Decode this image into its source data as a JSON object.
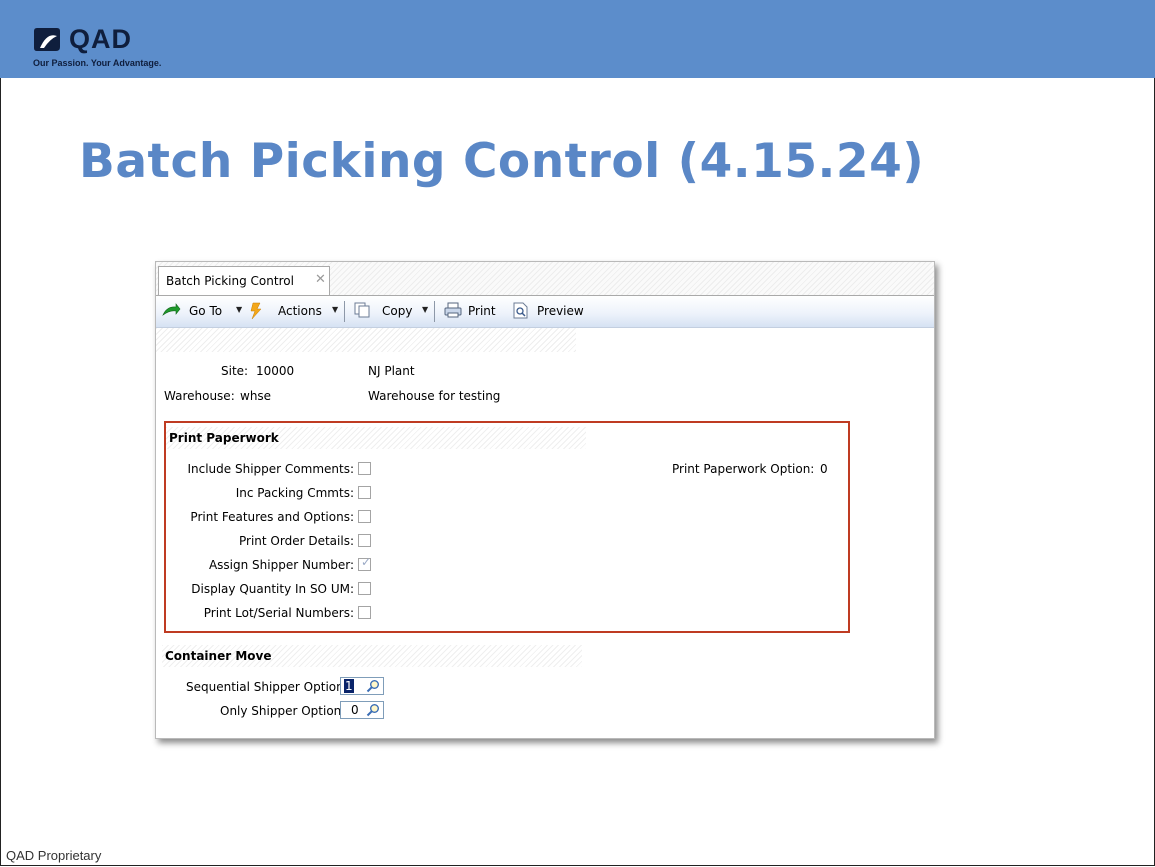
{
  "colors": {
    "header_band": "#5c8dcb",
    "title": "#5a87c6",
    "highlight_border": "#bf3b22",
    "selection": "#0a246a"
  },
  "brand": {
    "logo_text": "QAD",
    "tagline": "Our Passion. Your Advantage."
  },
  "slide": {
    "title": "Batch Picking Control (4.15.24)",
    "footer": "QAD Proprietary"
  },
  "window": {
    "tab": {
      "label": "Batch Picking Control",
      "close_icon": "close-icon"
    },
    "toolbar": {
      "goto_label": "Go To",
      "actions_label": "Actions",
      "copy_label": "Copy",
      "print_label": "Print",
      "preview_label": "Preview"
    },
    "header_fields": {
      "site_label": "Site:",
      "site_value": "10000",
      "site_desc": "NJ Plant",
      "warehouse_label": "Warehouse:",
      "warehouse_value": "whse",
      "warehouse_desc": "Warehouse for testing"
    },
    "print_paperwork": {
      "title": "Print Paperwork",
      "option_label": "Print Paperwork Option:",
      "option_value": "0",
      "items": [
        {
          "label": "Include Shipper Comments:",
          "checked": false
        },
        {
          "label": "Inc Packing Cmmts:",
          "checked": false
        },
        {
          "label": "Print Features and Options:",
          "checked": false
        },
        {
          "label": "Print Order Details:",
          "checked": false
        },
        {
          "label": "Assign Shipper Number:",
          "checked": true
        },
        {
          "label": "Display Quantity In SO UM:",
          "checked": false
        },
        {
          "label": "Print Lot/Serial Numbers:",
          "checked": false
        }
      ]
    },
    "container_move": {
      "title": "Container Move",
      "sequential_label": "Sequential Shipper Option:",
      "sequential_value": "1",
      "only_label": "Only Shipper Option:",
      "only_value": "0"
    }
  }
}
